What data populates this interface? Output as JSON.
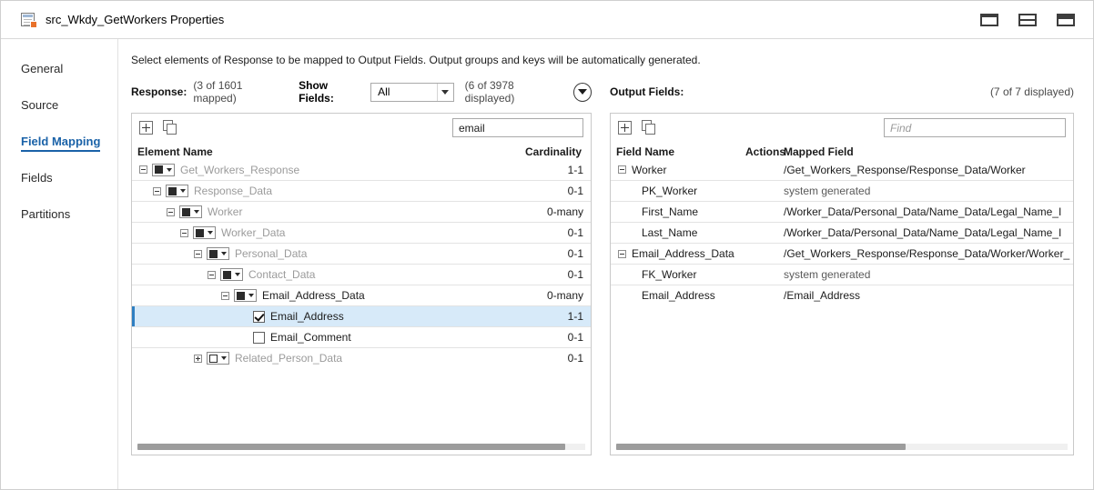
{
  "window": {
    "title": "src_Wkdy_GetWorkers Properties",
    "icon": "table-properties-icon",
    "buttons": [
      {
        "name": "view-full-button",
        "icon": "panel-full-icon"
      },
      {
        "name": "view-split-button",
        "icon": "panel-split-icon"
      },
      {
        "name": "view-tabbed-button",
        "icon": "panel-tabbed-icon"
      }
    ]
  },
  "sidebar": {
    "items": [
      {
        "label": "General",
        "active": false
      },
      {
        "label": "Source",
        "active": false
      },
      {
        "label": "Field Mapping",
        "active": true
      },
      {
        "label": "Fields",
        "active": false
      },
      {
        "label": "Partitions",
        "active": false
      }
    ]
  },
  "main": {
    "instruction": "Select elements of Response to be mapped to Output Fields. Output groups and keys will be automatically generated.",
    "left": {
      "title": "Response:",
      "mapped_count": "(3 of 1601 mapped)",
      "show_fields_label": "Show Fields:",
      "show_fields_value": "All",
      "displayed_count": "(6 of 3978 displayed)",
      "filter_icon": "filter-funnel-icon",
      "toolbar": {
        "new_icon": "new-node-icon",
        "copy_icon": "copy-icon"
      },
      "search_value": "email",
      "search_placeholder": "Find",
      "columns": {
        "element_name": "Element Name",
        "cardinality": "Cardinality"
      },
      "rows": [
        {
          "name": "Get_Workers_Response",
          "cardinality": "1-1",
          "indent": 0,
          "expander": "minus",
          "type_icon": "filled-square-dropdown",
          "control": "typebox",
          "dim": true,
          "selected": false
        },
        {
          "name": "Response_Data",
          "cardinality": "0-1",
          "indent": 1,
          "expander": "minus",
          "type_icon": "filled-square-dropdown",
          "control": "typebox",
          "dim": true,
          "selected": false
        },
        {
          "name": "Worker",
          "cardinality": "0-many",
          "indent": 2,
          "expander": "minus",
          "type_icon": "filled-square-dropdown",
          "control": "typebox",
          "dim": true,
          "selected": false
        },
        {
          "name": "Worker_Data",
          "cardinality": "0-1",
          "indent": 3,
          "expander": "minus",
          "type_icon": "filled-square-dropdown",
          "control": "typebox",
          "dim": true,
          "selected": false
        },
        {
          "name": "Personal_Data",
          "cardinality": "0-1",
          "indent": 4,
          "expander": "minus",
          "type_icon": "filled-square-dropdown",
          "control": "typebox",
          "dim": true,
          "selected": false
        },
        {
          "name": "Contact_Data",
          "cardinality": "0-1",
          "indent": 5,
          "expander": "minus",
          "type_icon": "filled-square-dropdown",
          "control": "typebox",
          "dim": true,
          "selected": false
        },
        {
          "name": "Email_Address_Data",
          "cardinality": "0-many",
          "indent": 6,
          "expander": "minus",
          "type_icon": "filled-square-dropdown",
          "control": "typebox",
          "dim": false,
          "selected": false
        },
        {
          "name": "Email_Address",
          "cardinality": "1-1",
          "indent": 8,
          "expander": "none",
          "type_icon": "checkbox-checked",
          "control": "checkbox",
          "checked": true,
          "dim": false,
          "selected": true
        },
        {
          "name": "Email_Comment",
          "cardinality": "0-1",
          "indent": 8,
          "expander": "none",
          "type_icon": "checkbox-unchecked",
          "control": "checkbox",
          "checked": false,
          "dim": false,
          "selected": false
        },
        {
          "name": "Related_Person_Data",
          "cardinality": "0-1",
          "indent": 4,
          "expander": "plus",
          "type_icon": "empty-square-dropdown",
          "control": "typebox-empty",
          "dim": true,
          "selected": false
        }
      ]
    },
    "right": {
      "title": "Output Fields:",
      "displayed_count": "(7 of 7 displayed)",
      "toolbar": {
        "new_icon": "new-field-icon",
        "copy_icon": "copy-icon"
      },
      "search_value": "",
      "search_placeholder": "Find",
      "columns": {
        "field_name": "Field Name",
        "actions": "Actions",
        "mapped_field": "Mapped Field"
      },
      "rows": [
        {
          "field": "Worker",
          "mapped": "/Get_Workers_Response/Response_Data/Worker",
          "expander": "minus",
          "indent": 0,
          "gray": false
        },
        {
          "field": "PK_Worker",
          "mapped": "system generated",
          "expander": "none",
          "indent": 1,
          "gray": true
        },
        {
          "field": "First_Name",
          "mapped": "/Worker_Data/Personal_Data/Name_Data/Legal_Name_I",
          "expander": "none",
          "indent": 1,
          "gray": false
        },
        {
          "field": "Last_Name",
          "mapped": "/Worker_Data/Personal_Data/Name_Data/Legal_Name_I",
          "expander": "none",
          "indent": 1,
          "gray": false
        },
        {
          "field": "Email_Address_Data",
          "mapped": "/Get_Workers_Response/Response_Data/Worker/Worker_",
          "expander": "minus",
          "indent": 0,
          "gray": false
        },
        {
          "field": "FK_Worker",
          "mapped": "system generated",
          "expander": "none",
          "indent": 1,
          "gray": true
        },
        {
          "field": "Email_Address",
          "mapped": "/Email_Address",
          "expander": "none",
          "indent": 1,
          "gray": false
        }
      ]
    }
  },
  "colors": {
    "accent": "#1a62a8",
    "selection": "#d7eaf9",
    "selection_bar": "#2f7fc1",
    "orange": "#e8712a"
  }
}
